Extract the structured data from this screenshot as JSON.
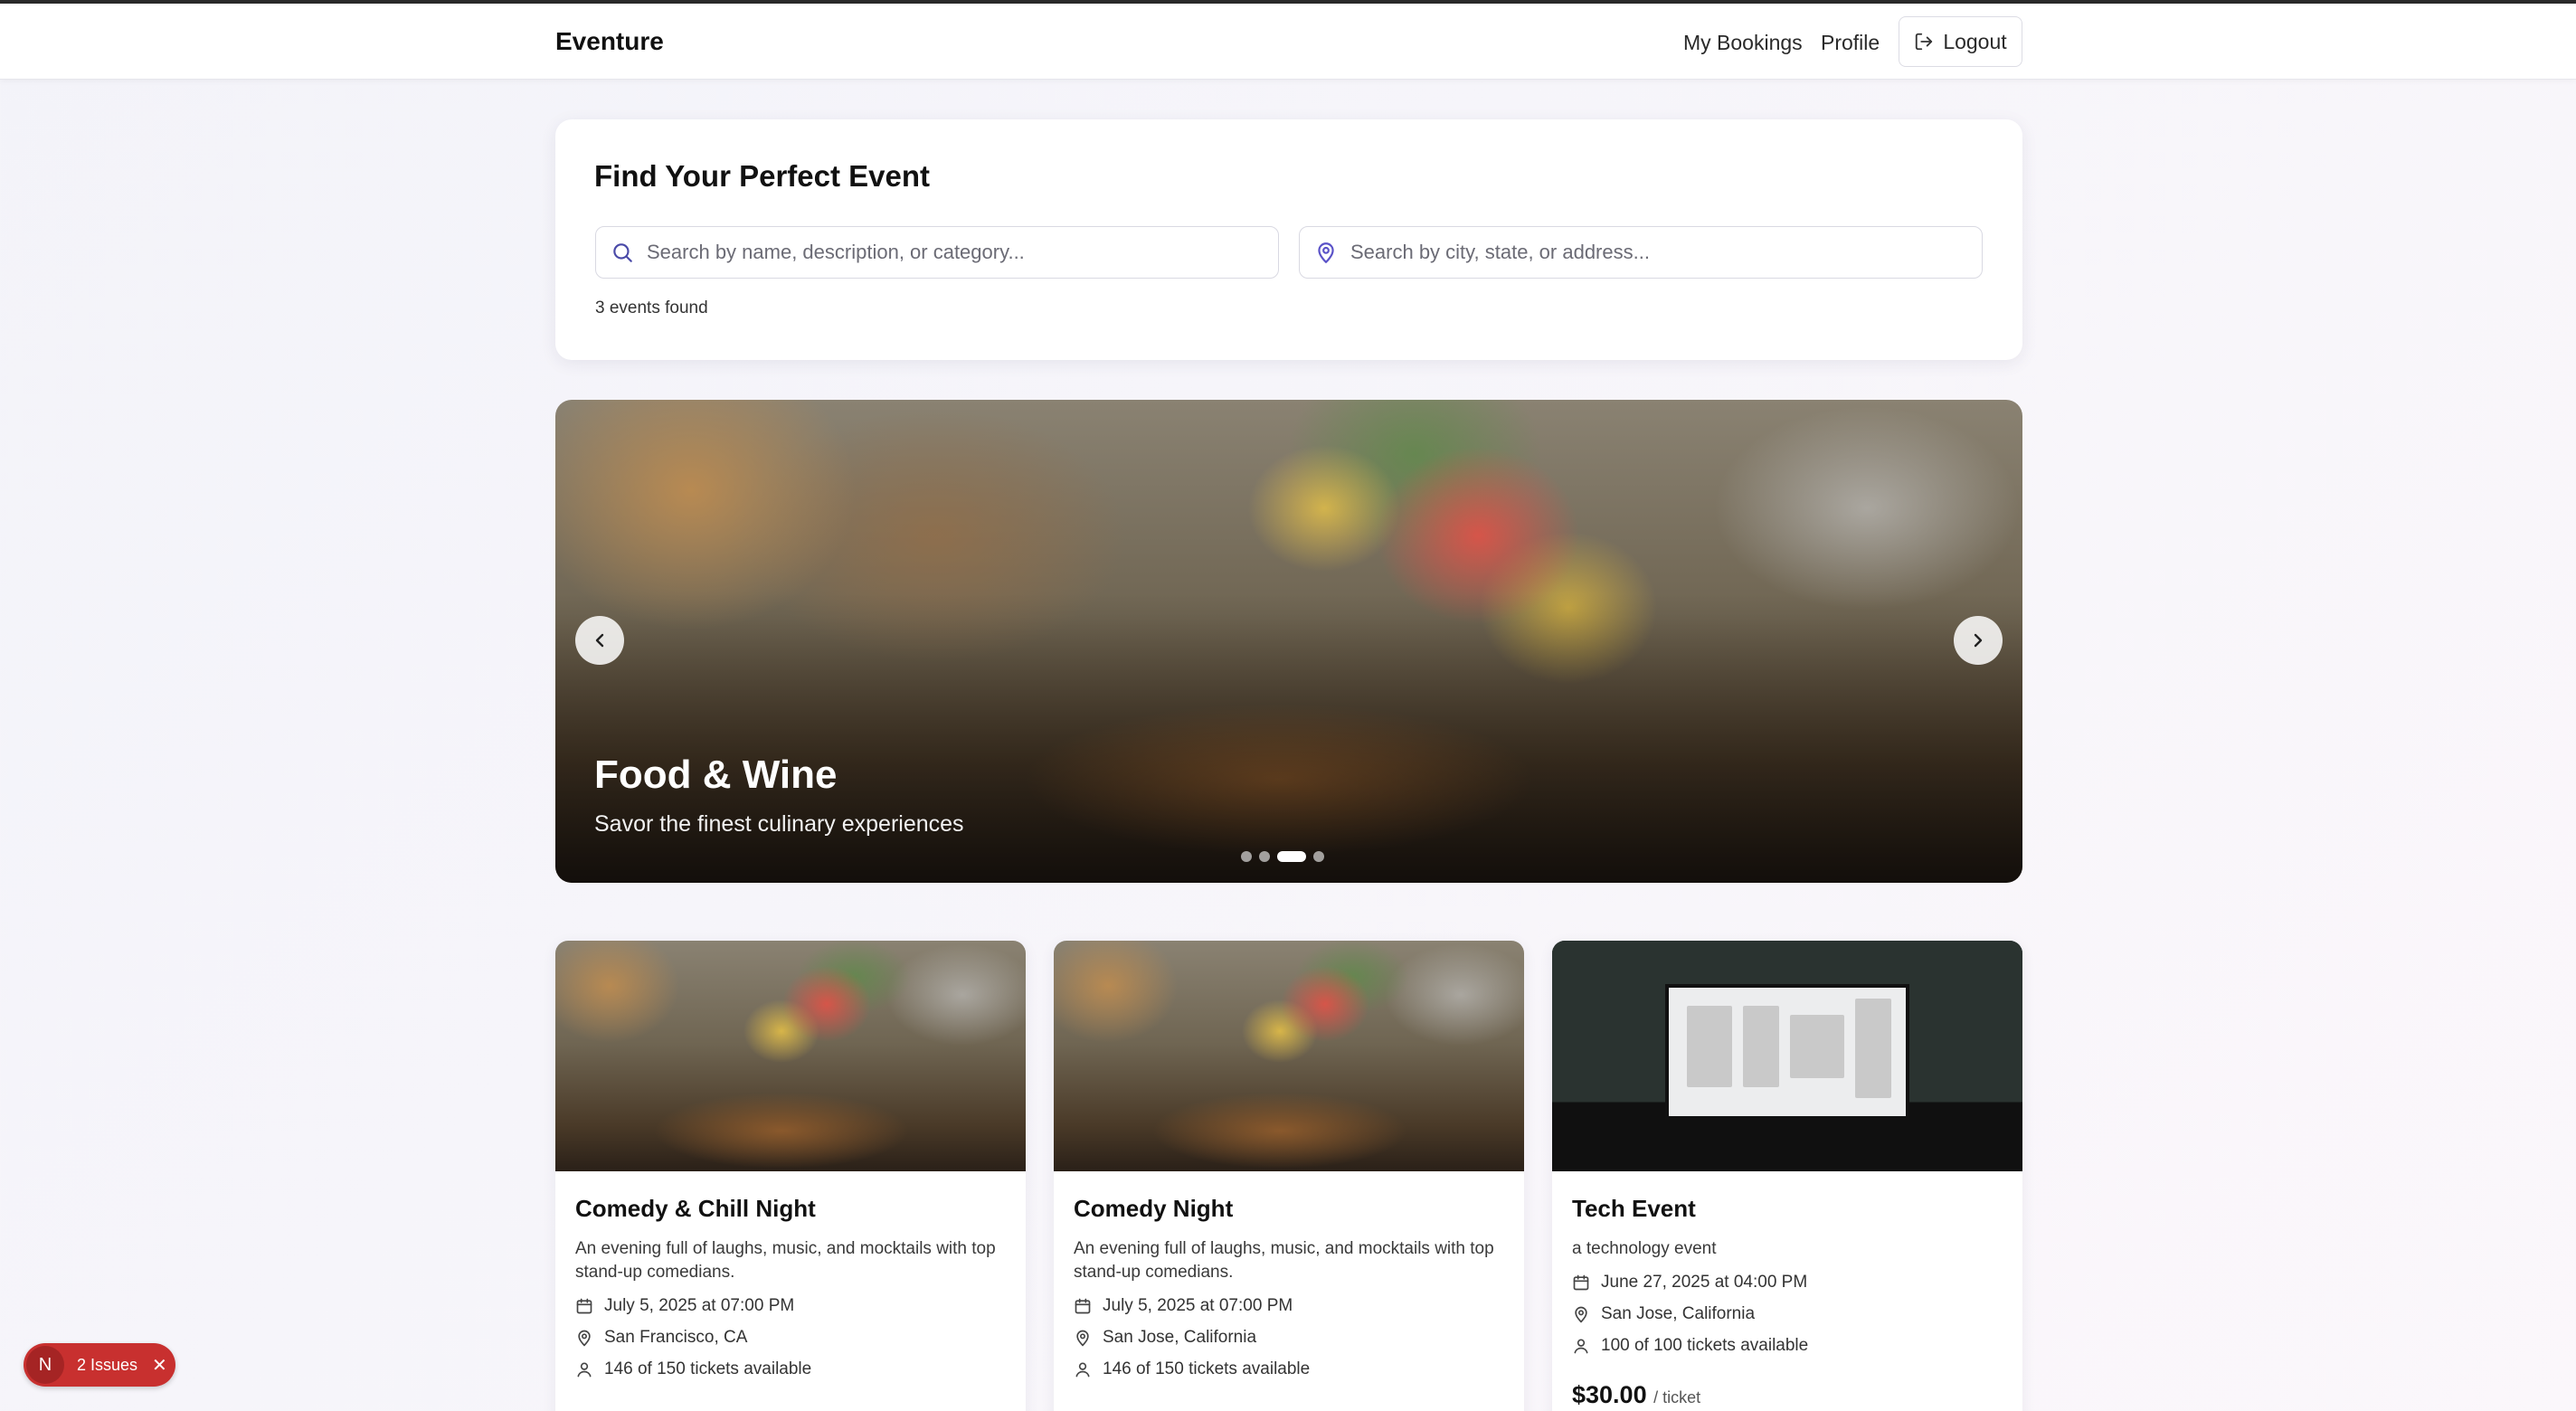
{
  "nav": {
    "brand": "Eventure",
    "my_bookings": "My Bookings",
    "profile": "Profile",
    "logout": "Logout"
  },
  "search": {
    "title": "Find Your Perfect Event",
    "name_placeholder": "Search by name, description, or category...",
    "location_placeholder": "Search by city, state, or address...",
    "count": "3 events found"
  },
  "hero": {
    "title": "Food & Wine",
    "subtitle": "Savor the finest culinary experiences",
    "slide_count": 4,
    "active_slide": 3
  },
  "events": [
    {
      "title": "Comedy & Chill Night",
      "description": "An evening full of laughs, music, and mocktails with top stand-up comedians.",
      "date": "July 5, 2025 at 07:00 PM",
      "location": "San Francisco, CA",
      "tickets": "146 of 150 tickets available",
      "image": "food-wine"
    },
    {
      "title": "Comedy Night",
      "description": "An evening full of laughs, music, and mocktails with top stand-up comedians.",
      "date": "July 5, 2025 at 07:00 PM",
      "location": "San Jose, California",
      "tickets": "146 of 150 tickets available",
      "image": "food-wine"
    },
    {
      "title": "Tech Event",
      "description": "a technology event",
      "date": "June 27, 2025 at 04:00 PM",
      "location": "San Jose, California",
      "tickets": "100 of 100 tickets available",
      "price": "$30.00",
      "price_unit": "/ ticket",
      "image": "tech-stage"
    }
  ],
  "issues_badge": {
    "letter": "N",
    "label": "2 Issues",
    "close": "✕"
  },
  "colors": {
    "issues_red": "#c8302f",
    "location_icon": "#5a52c8",
    "search_icon": "#4a4aa8"
  },
  "icons": {
    "search": "search-icon",
    "location": "map-pin-icon",
    "calendar": "calendar-icon",
    "user": "user-icon",
    "logout": "logout-icon",
    "prev": "chevron-left-icon",
    "next": "chevron-right-icon"
  }
}
